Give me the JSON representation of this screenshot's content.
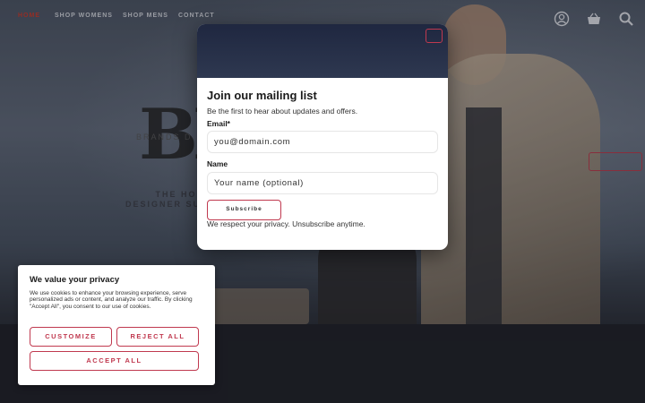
{
  "nav": {
    "items": [
      {
        "label": "HOME"
      },
      {
        "label": "SHOP WOMENS"
      },
      {
        "label": "SHOP MENS"
      },
      {
        "label": "CONTACT"
      }
    ],
    "icons": [
      "user-icon",
      "basket-icon",
      "search-icon"
    ]
  },
  "hero": {
    "logo": "BD",
    "brand_small": "BRANDS D",
    "tagline_1": "THE HOM",
    "tagline_2": "DESIGNER SUN"
  },
  "modal": {
    "title": "Join our mailing list",
    "subtitle": "Be the first to hear about updates and offers.",
    "email_label": "Email*",
    "email_value": "you@domain.com",
    "name_label": "Name",
    "name_placeholder": "Your name (optional)",
    "subscribe_label": "Subscribe",
    "privacy_note": "We respect your privacy. Unsubscribe anytime."
  },
  "cookie": {
    "title": "We value your privacy",
    "text": "We use cookies to enhance your browsing experience, serve personalized ads or content, and analyze our traffic. By clicking \"Accept All\", you consent to our use of cookies.",
    "customize_label": "CUSTOMIZE",
    "reject_label": "REJECT ALL",
    "accept_label": "ACCEPT ALL"
  },
  "colors": {
    "accent": "#c0394f",
    "nav_active": "#c0392b",
    "modal_header": "#1f2740"
  }
}
